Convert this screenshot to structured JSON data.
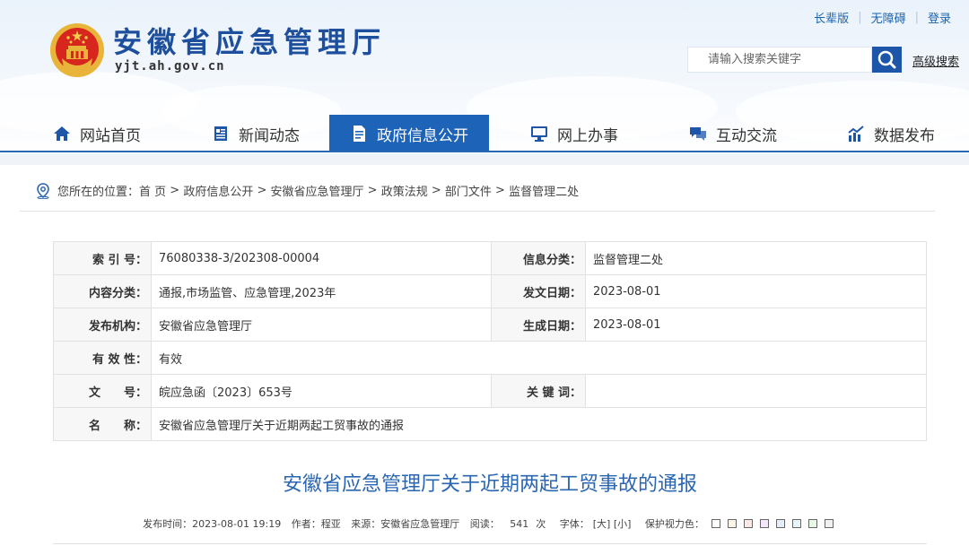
{
  "header": {
    "site_name": "安徽省应急管理厅",
    "domain": "yjt.ah.gov.cn",
    "top_links": [
      "长辈版",
      "无障碍",
      "登录"
    ],
    "search_placeholder": "请输入搜索关键字",
    "advanced_search": "高级搜索"
  },
  "nav": {
    "items": [
      {
        "label": "网站首页",
        "icon": "home-icon"
      },
      {
        "label": "新闻动态",
        "icon": "news-icon"
      },
      {
        "label": "政府信息公开",
        "icon": "document-icon",
        "active": true
      },
      {
        "label": "网上办事",
        "icon": "monitor-icon"
      },
      {
        "label": "互动交流",
        "icon": "chat-icon"
      },
      {
        "label": "数据发布",
        "icon": "chart-icon"
      }
    ]
  },
  "breadcrumb": {
    "prefix": "您所在的位置：",
    "items": [
      "首 页",
      "政府信息公开",
      "安徽省应急管理厅",
      "政策法规",
      "部门文件",
      "监督管理二处"
    ],
    "separator": " > "
  },
  "meta": {
    "index_label": "索 引 号：",
    "index_value": "76080338-3/202308-00004",
    "category_label": "信息分类：",
    "category_value": "监督管理二处",
    "content_label": "内容分类：",
    "content_value": "通报,市场监管、应急管理,2023年",
    "issue_date_label": "发文日期：",
    "issue_date_value": "2023-08-01",
    "org_label": "发布机构：",
    "org_value": "安徽省应急管理厅",
    "gen_date_label": "生成日期：",
    "gen_date_value": "2023-08-01",
    "validity_label": "有 效 性：",
    "validity_value": "有效",
    "docno_label": "文　　号：",
    "docno_value": "皖应急函〔2023〕653号",
    "keywords_label": "关 键 词：",
    "keywords_value": "",
    "name_label": "名　　称：",
    "name_value": "安徽省应急管理厅关于近期两起工贸事故的通报"
  },
  "article": {
    "title": "安徽省应急管理厅关于近期两起工贸事故的通报",
    "publish_time": "发布时间：2023-08-01 19:19",
    "author": "作者：程亚",
    "source": "来源：安徽省应急管理厅",
    "reads_label": "阅读：",
    "reads_value": "541",
    "reads_unit": "次",
    "font_size_label": "字体：",
    "font_large": "[大]",
    "font_small": "[小]",
    "eye_color_label": "保护视力色：",
    "eye_colors": [
      "#ffffff",
      "#faf5e6",
      "#fbe8e8",
      "#f5e6fa",
      "#e6edfa",
      "#e6f5fa",
      "#e8fae6",
      "#f0f0f0"
    ]
  },
  "colors": {
    "brand_blue": "#1d63b8",
    "title_blue": "#2a66b2",
    "link_blue": "#1a63b0"
  }
}
